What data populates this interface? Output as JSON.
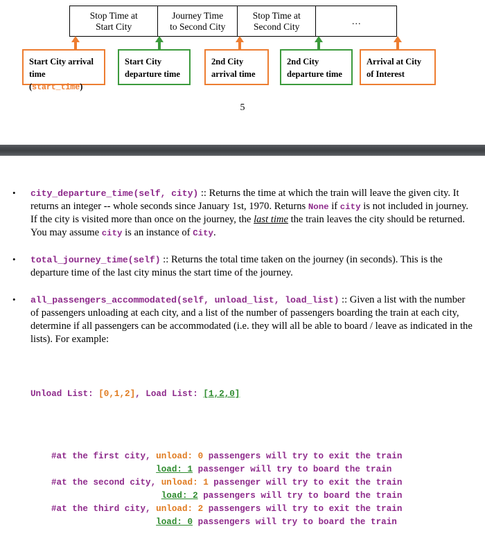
{
  "page_one": {
    "timeline_cells": [
      "Stop Time at\nStart City",
      "Journey Time\nto Second City",
      "Stop Time at\nSecond City",
      "…"
    ],
    "label_boxes": [
      {
        "line1": "Start City arrival",
        "line2_prefix": "time (",
        "line2_code": "start_time",
        "line2_suffix": ")",
        "color": "#ED7D31",
        "arrow_color": "#ED7D31"
      },
      {
        "line1": "Start City",
        "line2": "departure time",
        "color": "#3C9A3C",
        "arrow_color": "#3C9A3C"
      },
      {
        "line1": "2nd City",
        "line2": "arrival time",
        "color": "#ED7D31",
        "arrow_color": "#ED7D31"
      },
      {
        "line1": "2nd City",
        "line2": "departure time",
        "color": "#3C9A3C",
        "arrow_color": "#3C9A3C"
      },
      {
        "line1": "Arrival at City",
        "line2": "of Interest",
        "color": "#ED7D31",
        "arrow_color": "#ED7D31"
      }
    ],
    "page_number": "5"
  },
  "page_two": {
    "bullet_glyph": "•",
    "items": [
      {
        "signature": "city_departure_time(self, city)",
        "sep": " :: ",
        "text_a": "Returns the time at which the train will leave the given city. It returns an integer -- whole seconds since January 1st, 1970.  Returns ",
        "code_b": "None",
        "text_c": " if ",
        "code_d": "city",
        "text_e": " is not included in journey.  If the city is visited more than once on the journey, the ",
        "emph_f": "last time",
        "text_g": " the train leaves the city should be returned. You may assume ",
        "code_h": "city",
        "text_i": " is an instance of ",
        "code_j": "City",
        "text_k": "."
      },
      {
        "signature": "total_journey_time(self)",
        "sep": " :: ",
        "text_a": "Returns the total time taken on the journey (in seconds). This is the departure time of the last city minus the start time of the journey."
      },
      {
        "signature": "all_passengers_accommodated(self, unload_list, load_list)",
        "sep": " :: ",
        "text_a": "Given a list with the number of passengers unloading at each city, and a list of the number of passengers boarding the train at each city, determine if all passengers can be accommodated (i.e. they will all be able to board / leave as indicated in the lists). For example:"
      }
    ],
    "example": {
      "unload_label": "Unload List: ",
      "unload_value": "[0,1,2]",
      "middle": ", ",
      "load_label": "Load List: ",
      "load_value": "[1,2,0]",
      "lines": [
        {
          "prefix": "#at the first city, ",
          "key": "unload: ",
          "value": "0",
          "suffix": " passengers will try to exit the train",
          "style": "orange"
        },
        {
          "prefix": "                    ",
          "key": "load: ",
          "value": "1",
          "suffix": " passenger will try to board the train",
          "style": "green"
        },
        {
          "prefix": "#at the second city, ",
          "key": "unload: ",
          "value": "1",
          "suffix": " passenger will try to exit the train",
          "style": "orange"
        },
        {
          "prefix": "                     ",
          "key": "load: ",
          "value": "2",
          "suffix": " passengers will try to board the train",
          "style": "green"
        },
        {
          "prefix": "#at the third city, ",
          "key": "unload: ",
          "value": "2",
          "suffix": " passengers will try to exit the train",
          "style": "orange"
        },
        {
          "prefix": "                    ",
          "key": "load: ",
          "value": "0",
          "suffix": " passengers will try to board the train",
          "style": "green"
        }
      ]
    }
  },
  "colors": {
    "orange": "#ED7D31",
    "green": "#3C9A3C",
    "code_purple": "#8E2A8B",
    "divider_gray": "#43464a"
  }
}
